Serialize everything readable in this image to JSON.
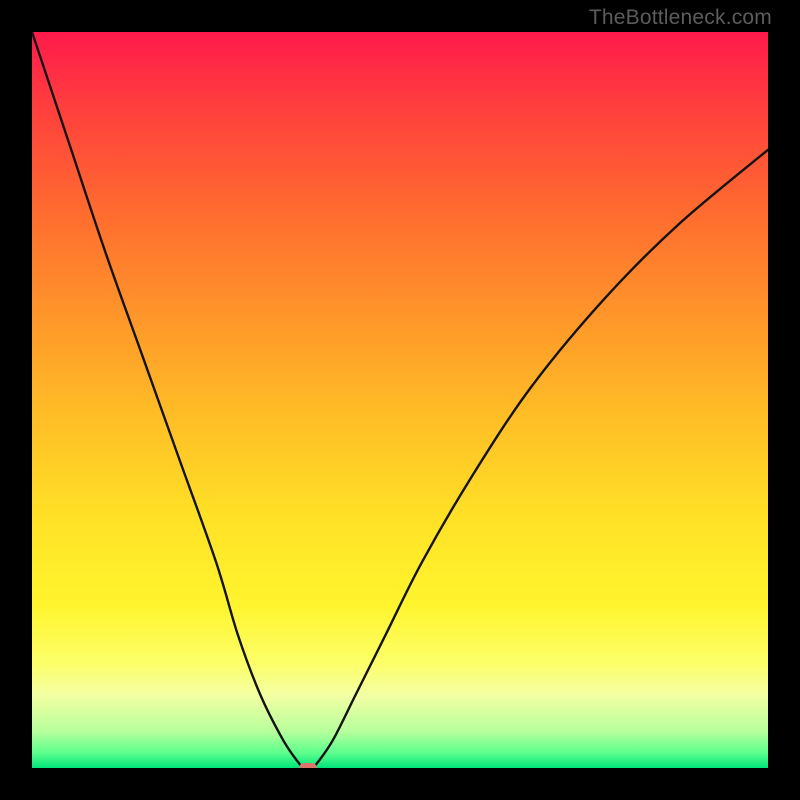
{
  "watermark": {
    "text": "TheBottleneck.com"
  },
  "chart_data": {
    "type": "line",
    "title": "",
    "xlabel": "",
    "ylabel": "",
    "xlim": [
      0,
      100
    ],
    "ylim": [
      0,
      100
    ],
    "grid": false,
    "legend": false,
    "series": [
      {
        "name": "bottleneck-curve",
        "x": [
          0,
          5,
          10,
          15,
          20,
          25,
          28,
          31,
          34,
          36,
          37,
          38,
          39,
          41,
          44,
          48,
          53,
          60,
          68,
          78,
          88,
          100
        ],
        "y": [
          100,
          85,
          70,
          56,
          42,
          28,
          18,
          10,
          4,
          1,
          0,
          0,
          1,
          4,
          10,
          18,
          28,
          40,
          52,
          64,
          74,
          84
        ]
      }
    ],
    "markers": [
      {
        "name": "minimum-marker",
        "x": 37.5,
        "y": 0,
        "color": "#d8766e"
      }
    ],
    "background": {
      "type": "vertical-gradient",
      "stops": [
        {
          "pos": 0.0,
          "color": "#ff1a4b"
        },
        {
          "pos": 0.25,
          "color": "#ff6d2f"
        },
        {
          "pos": 0.52,
          "color": "#ffbd26"
        },
        {
          "pos": 0.78,
          "color": "#fff52e"
        },
        {
          "pos": 0.95,
          "color": "#b8ff9c"
        },
        {
          "pos": 1.0,
          "color": "#00e27a"
        }
      ]
    }
  },
  "colors": {
    "frame": "#000000",
    "curve": "#141414",
    "marker": "#d8766e",
    "watermark": "#5c5c5c"
  }
}
